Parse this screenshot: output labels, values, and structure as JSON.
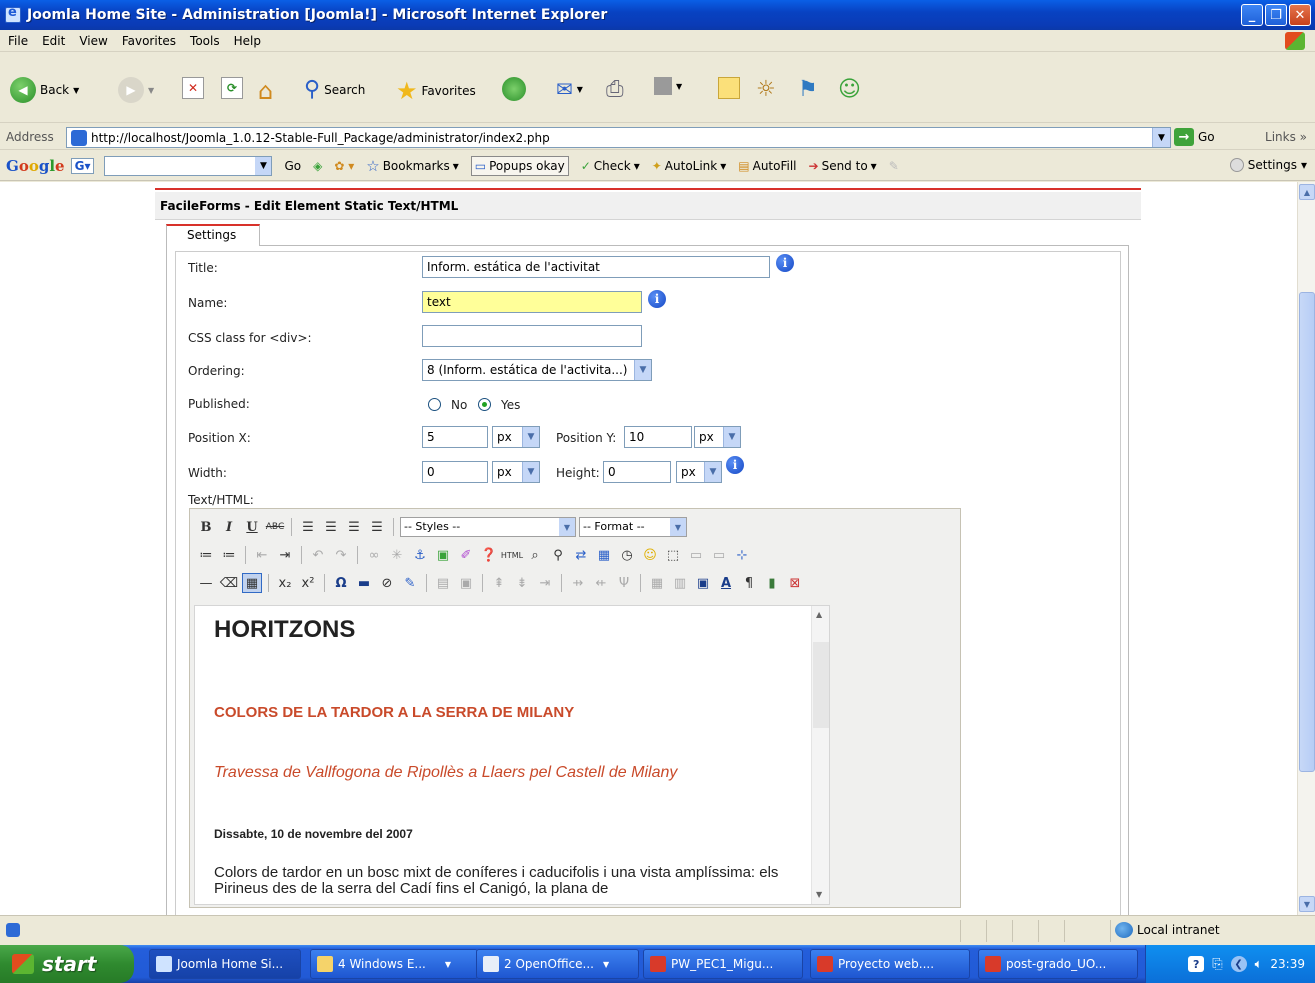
{
  "window": {
    "title": "Joomla Home Site - Administration [Joomla!] - Microsoft Internet Explorer",
    "min_glyph": "_",
    "max_glyph": "❐",
    "close_glyph": "✕"
  },
  "menu": [
    "File",
    "Edit",
    "View",
    "Favorites",
    "Tools",
    "Help"
  ],
  "toolbar": {
    "back": "Back",
    "search": "Search",
    "favorites": "Favorites"
  },
  "address": {
    "label": "Address",
    "url": "http://localhost/Joomla_1.0.12-Stable-Full_Package/administrator/index2.php",
    "go": "Go",
    "links": "Links"
  },
  "google": {
    "logo": [
      "G",
      "o",
      "o",
      "g",
      "l",
      "e"
    ],
    "go": "Go",
    "bookmarks": "Bookmarks",
    "popups": "Popups okay",
    "check": "Check",
    "autolink": "AutoLink",
    "autofill": "AutoFill",
    "sendto": "Send to",
    "settings": "Settings"
  },
  "panel": {
    "header": "FacileForms - Edit Element Static Text/HTML",
    "tab": "Settings"
  },
  "form": {
    "title_label": "Title:",
    "title_value": "Inform. estática de l'activitat",
    "name_label": "Name:",
    "name_value": "text",
    "css_label": "CSS class for <div>:",
    "css_value": "",
    "ordering_label": "Ordering:",
    "ordering_value": "8 (Inform. estática de l'activita...)",
    "published_label": "Published:",
    "published_no": "No",
    "published_yes": "Yes",
    "published_selected": "Yes",
    "posx_label": "Position X:",
    "posx_value": "5",
    "posx_unit": "px",
    "posy_label": "Position Y:",
    "posy_value": "10",
    "posy_unit": "px",
    "width_label": "Width:",
    "width_value": "0",
    "width_unit": "px",
    "height_label": "Height:",
    "height_value": "0",
    "height_unit": "px",
    "texthtml_label": "Text/HTML:"
  },
  "editor": {
    "styles": "-- Styles --",
    "format": "-- Format --",
    "content": {
      "h1": "HORITZONS",
      "h2": "COLORS DE LA TARDOR A LA SERRA DE MILANY",
      "h3": "Travessa de Vallfogona de Ripollès a Llaers pel Castell de Milany",
      "date": "Dissabte, 10 de novembre del 2007",
      "para": "Colors de tardor en un bosc mixt de coníferes i caducifolis i una vista amplíssima: els Pirineus des de la serra del Cadí fins el Canigó, la plana de"
    }
  },
  "status": {
    "zone": "Local intranet"
  },
  "taskbar": {
    "start": "start",
    "items": [
      "Joomla Home Si...",
      "4 Windows E...",
      "2 OpenOffice...",
      "PW_PEC1_Migu...",
      "Proyecto web....",
      "post-grado_UO..."
    ],
    "clock": "23:39"
  },
  "colors": {
    "accent_red": "#d8312a",
    "heading_red": "#c94a2a",
    "name_field_bg": "#ffff99",
    "xp_blue": "#245edb"
  }
}
